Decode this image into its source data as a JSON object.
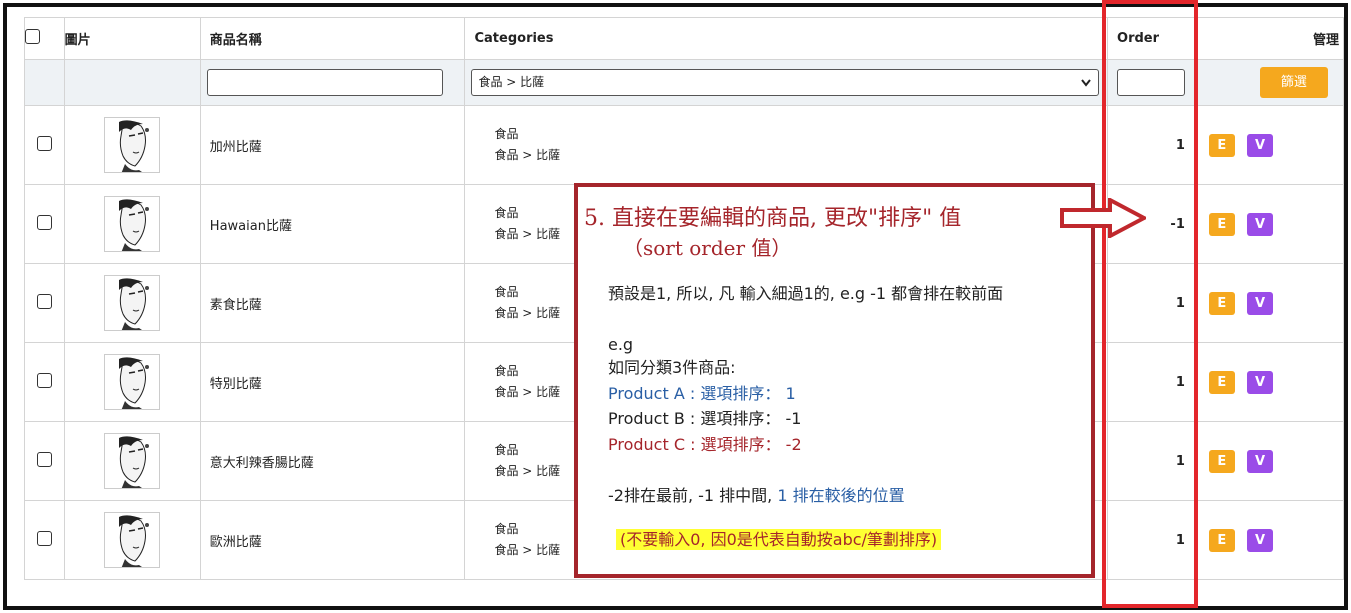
{
  "table": {
    "headers": {
      "image": "圖片",
      "product_name": "商品名稱",
      "categories": "Categories",
      "order": "Order",
      "manage": "管理"
    },
    "filter": {
      "name_value": "",
      "category_selected": "食品 > 比薩",
      "order_value": "",
      "filter_button": "篩選"
    },
    "rows": [
      {
        "name": "加州比薩",
        "cat1": "食品",
        "cat2": "食品 > 比薩",
        "order": "1",
        "edit": "E",
        "view": "V"
      },
      {
        "name": "Hawaian比薩",
        "cat1": "食品",
        "cat2": "食品 > 比薩",
        "order": "-1",
        "edit": "E",
        "view": "V"
      },
      {
        "name": "素食比薩",
        "cat1": "食品",
        "cat2": "食品 > 比薩",
        "order": "1",
        "edit": "E",
        "view": "V"
      },
      {
        "name": "特別比薩",
        "cat1": "食品",
        "cat2": "食品 > 比薩",
        "order": "1",
        "edit": "E",
        "view": "V"
      },
      {
        "name": "意大利辣香腸比薩",
        "cat1": "食品",
        "cat2": "食品 > 比薩",
        "order": "1",
        "edit": "E",
        "view": "V"
      },
      {
        "name": "歐洲比薩",
        "cat1": "食品",
        "cat2": "食品 > 比薩",
        "order": "1",
        "edit": "E",
        "view": "V"
      }
    ]
  },
  "annotation": {
    "title": "5. 直接在要編輯的商品, 更改\"排序\" 值",
    "subtitle": "（sort order 值）",
    "line1": "預設是1, 所以, 凡 輸入細過1的, e.g -1 都會排在較前面",
    "line2": "e.g",
    "line3": "如同分類3件商品:",
    "product_a_label": "Product A : 選項排序：",
    "product_a_value": "1",
    "product_b_label": "Product B : 選項排序：",
    "product_b_value": "-1",
    "product_c_label": "Product C : 選項排序：",
    "product_c_value": "-2",
    "summary_part1": "-2排在最前, -1 排中間,",
    "summary_part2": "1 排在較後的位置",
    "note": "(不要輸入0, 因0是代表自動按abc/筆劃排序)"
  },
  "colors": {
    "highlight_border": "#e3262b",
    "callout_border": "#a5252b",
    "edit_button": "#f5a81e",
    "view_button": "#9a4ce8",
    "note_highlight": "#ffff33"
  },
  "icons": {
    "arrow": "arrow-right-icon",
    "thumbnail": "product-thumbnail"
  }
}
